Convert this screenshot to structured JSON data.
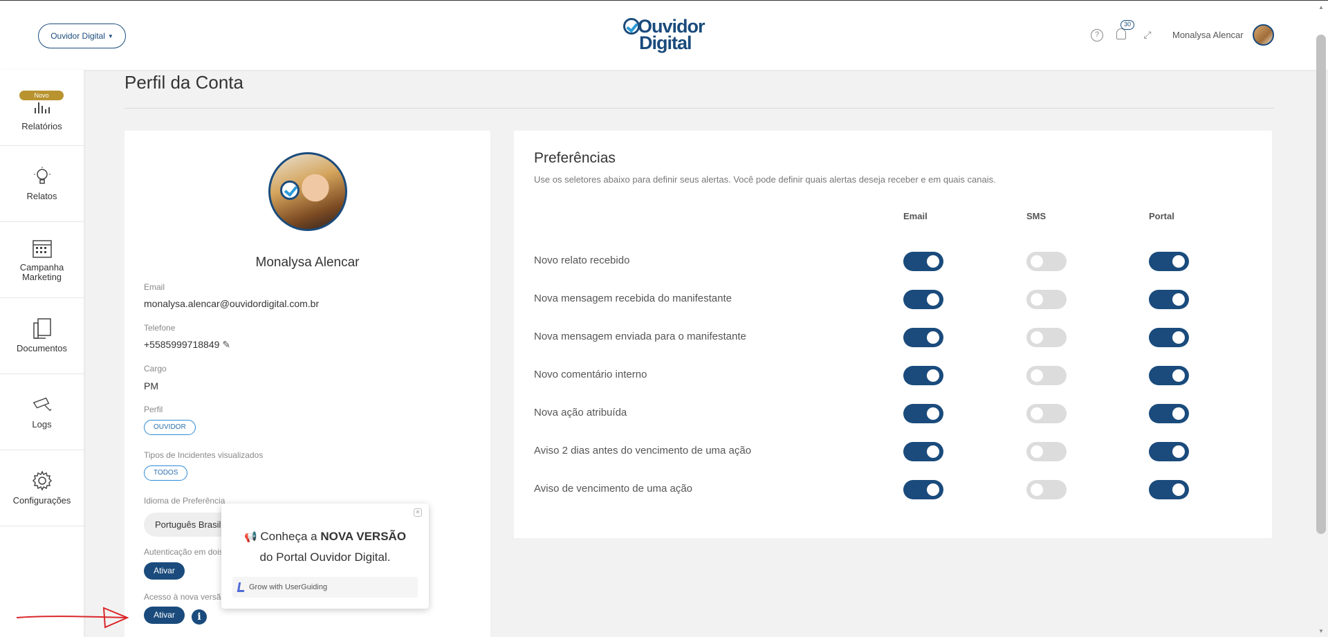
{
  "header": {
    "org_select": "Ouvidor Digital",
    "logo_line1": "Ouvidor",
    "logo_line2": "Digital",
    "notification_count": "30",
    "user_name": "Monalysa Alencar"
  },
  "sidebar": {
    "items": [
      {
        "label": "Relatórios",
        "icon": "bar-chart-icon",
        "badge": "Novo"
      },
      {
        "label": "Relatos",
        "icon": "lightbulb-icon"
      },
      {
        "label": "Campanha Marketing",
        "icon": "calendar-icon"
      },
      {
        "label": "Documentos",
        "icon": "documents-icon"
      },
      {
        "label": "Logs",
        "icon": "camera-icon"
      },
      {
        "label": "Configurações",
        "icon": "gear-icon"
      }
    ]
  },
  "page": {
    "title": "Perfil da Conta"
  },
  "profile": {
    "name": "Monalysa Alencar",
    "email_label": "Email",
    "email": "monalysa.alencar@ouvidordigital.com.br",
    "phone_label": "Telefone",
    "phone": "+5585999718849",
    "role_label": "Cargo",
    "role": "PM",
    "profile_label": "Perfil",
    "profile_tag": "OUVIDOR",
    "incident_types_label": "Tipos de Incidentes visualizados",
    "incident_types_tag": "TODOS",
    "language_label": "Idioma de Preferência",
    "language": "Português Brasileiro",
    "two_factor_label": "Autenticação em dois fatores",
    "two_factor_button": "Ativar",
    "new_version_label": "Acesso à nova versão",
    "new_version_button": "Ativar"
  },
  "popup": {
    "text_prefix": "Conheça a ",
    "text_bold": "NOVA VERSÃO",
    "text_line2": "do Portal Ouvidor Digital.",
    "footer": "Grow with UserGuiding"
  },
  "preferences": {
    "title": "Preferências",
    "subtitle": "Use os seletores abaixo para definir seus alertas. Você pode definir quais alertas deseja receber e em quais canais.",
    "columns": [
      "Email",
      "SMS",
      "Portal"
    ],
    "rows": [
      {
        "label": "Novo relato recebido",
        "email": true,
        "sms": false,
        "portal": true
      },
      {
        "label": "Nova mensagem recebida do manifestante",
        "email": true,
        "sms": false,
        "portal": true
      },
      {
        "label": "Nova mensagem enviada para o manifestante",
        "email": true,
        "sms": false,
        "portal": true
      },
      {
        "label": "Novo comentário interno",
        "email": true,
        "sms": false,
        "portal": true
      },
      {
        "label": "Nova ação atribuída",
        "email": true,
        "sms": false,
        "portal": true
      },
      {
        "label": "Aviso 2 dias antes do vencimento de uma ação",
        "email": true,
        "sms": false,
        "portal": true
      },
      {
        "label": "Aviso de vencimento de uma ação",
        "email": true,
        "sms": false,
        "portal": true
      }
    ]
  },
  "colors": {
    "primary": "#1a4b7c",
    "accent": "#2b9ad6",
    "badge": "#b8932f",
    "toggle_off": "#dcdcdc"
  }
}
